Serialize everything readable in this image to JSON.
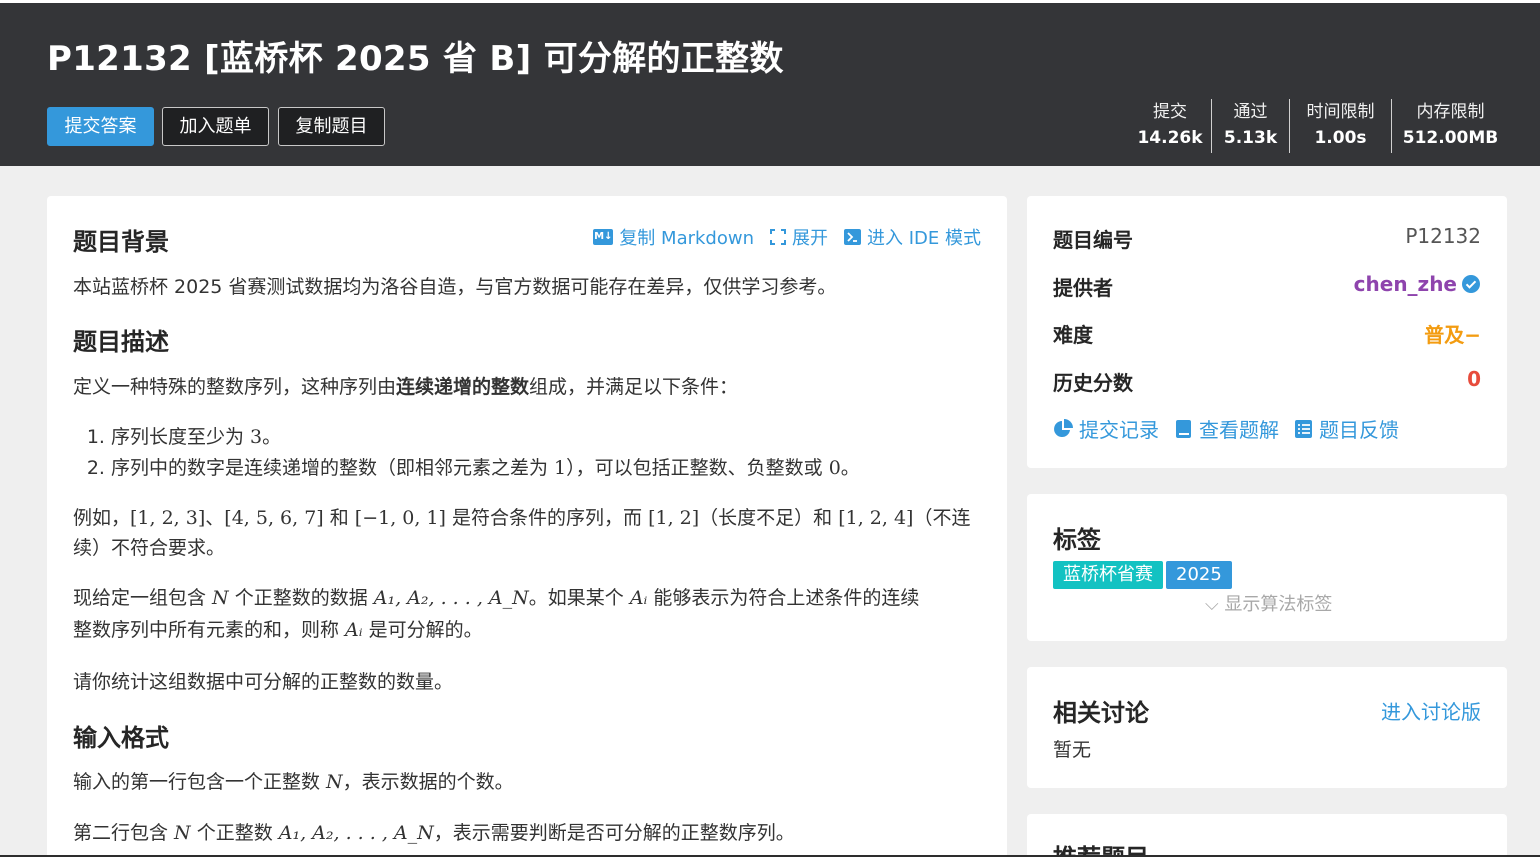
{
  "header": {
    "title": "P12132 [蓝桥杯 2025 省 B] 可分解的正整数",
    "buttons": {
      "submit": "提交答案",
      "add_list": "加入题单",
      "copy": "复制题目"
    },
    "stats": [
      {
        "label": "提交",
        "value": "14.26k"
      },
      {
        "label": "通过",
        "value": "5.13k"
      },
      {
        "label": "时间限制",
        "value": "1.00s"
      },
      {
        "label": "内存限制",
        "value": "512.00MB"
      }
    ]
  },
  "toolbar": {
    "md_icon": "M↓",
    "copy_md": "复制 Markdown",
    "expand": "展开",
    "ide": "进入 IDE 模式"
  },
  "content": {
    "bg_title": "题目背景",
    "bg_text": "本站蓝桥杯 2025 省赛测试数据均为洛谷自造，与官方数据可能存在差异，仅供学习参考。",
    "desc_title": "题目描述",
    "desc_p1_a": "定义一种特殊的整数序列，这种序列由",
    "desc_p1_b": "连续递增的整数",
    "desc_p1_c": "组成，并满足以下条件：",
    "list_1_a": "序列长度至少为 ",
    "list_1_m": "3",
    "list_1_b": "。",
    "list_2_a": "序列中的数字是连续递增的整数（即相邻元素之差为 ",
    "list_2_m1": "1",
    "list_2_b": "），可以包括正整数、负整数或 ",
    "list_2_m2": "0",
    "list_2_c": "。",
    "ex_a": "例如，",
    "ex_m1": "[1, 2, 3]",
    "ex_b": "、",
    "ex_m2": "[4, 5, 6, 7]",
    "ex_c": " 和 ",
    "ex_m3": "[−1, 0, 1]",
    "ex_d": " 是符合条件的序列，而 ",
    "ex_m4": "[1, 2]",
    "ex_e": "（长度不足）和 ",
    "ex_m5": "[1, 2, 4]",
    "ex_f": "（不连",
    "ex_line2": "续）不符合要求。",
    "given_a": "现给定一组包含 ",
    "given_m1": "N",
    "given_b": " 个正整数的数据 ",
    "given_m2": "A₁, A₂, . . . , A_N",
    "given_c": "。如果某个 ",
    "given_m3": "Aᵢ",
    "given_d": " 能够表示为符合上述条件的连续",
    "given_line2_a": "整数序列中所有元素的和，则称 ",
    "given_line2_m": "Aᵢ",
    "given_line2_b": " 是可分解的。",
    "count_text": "请你统计这组数据中可分解的正整数的数量。",
    "input_title": "输入格式",
    "input_p1_a": "输入的第一行包含一个正整数 ",
    "input_p1_m": "N",
    "input_p1_b": "，表示数据的个数。",
    "input_p2_a": "第二行包含 ",
    "input_p2_m1": "N",
    "input_p2_b": " 个正整数 ",
    "input_p2_m2": "A₁, A₂, . . . , A_N",
    "input_p2_c": "，表示需要判断是否可分解的正整数序列。"
  },
  "info": {
    "pid_label": "题目编号",
    "pid": "P12132",
    "provider_label": "提供者",
    "provider": "chen_zhe",
    "difficulty_label": "难度",
    "difficulty": "普及−",
    "score_label": "历史分数",
    "score": "0",
    "links": {
      "records": "提交记录",
      "solutions": "查看题解",
      "feedback": "题目反馈"
    }
  },
  "tags": {
    "title": "标签",
    "items": [
      "蓝桥杯省赛",
      "2025"
    ],
    "show_algo": "显示算法标签"
  },
  "discuss": {
    "title": "相关讨论",
    "enter": "进入讨论版",
    "empty": "暂无"
  },
  "recommend": {
    "title": "推荐题目"
  },
  "colors": {
    "accent": "#3498db",
    "provider": "#8e44ad",
    "difficulty": "#f39c11",
    "score": "#e74c3c",
    "tag_cyan": "#13c2c2"
  }
}
